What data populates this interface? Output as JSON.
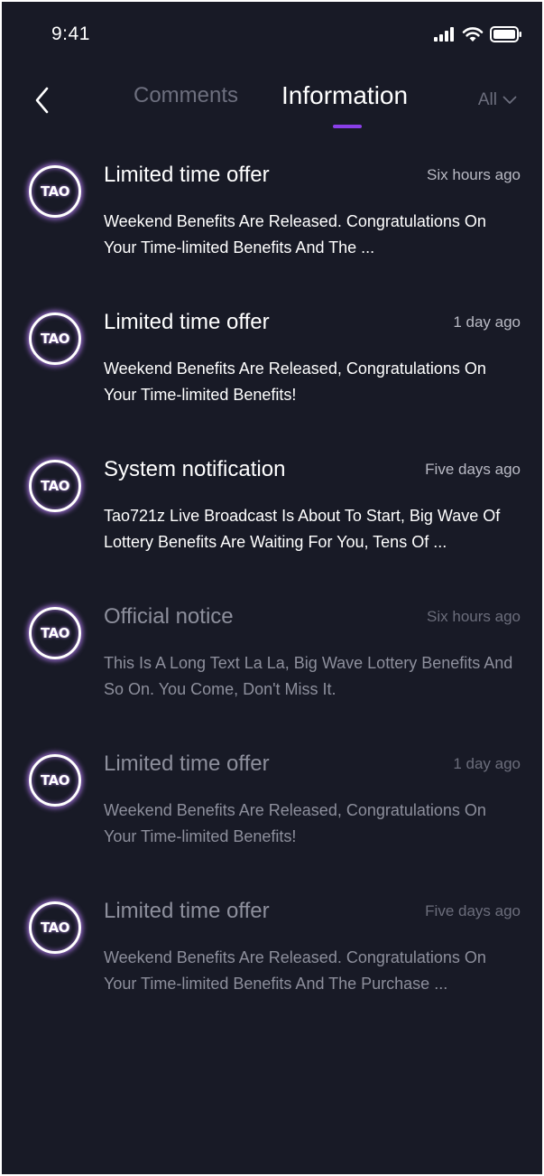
{
  "status_bar": {
    "time": "9:41",
    "icons": [
      "signal-icon",
      "wifi-icon",
      "battery-icon"
    ]
  },
  "nav": {
    "back_icon": "chevron-left-icon",
    "tabs": [
      {
        "label": "Comments",
        "active": false
      },
      {
        "label": "Information",
        "active": true
      }
    ],
    "filter_label": "All",
    "filter_icon": "chevron-down-icon"
  },
  "colors": {
    "background": "#181a26",
    "active_tab": "#ffffff",
    "inactive_tab": "#6d6f7e",
    "accent": "#8a3fe8",
    "avatar_glow": "#be82ff"
  },
  "avatar_label": "TAO",
  "messages": [
    {
      "title": "Limited time offer",
      "time": "Six hours ago",
      "body": "Weekend Benefits Are Released. Congratulations On Your Time-limited Benefits And The ...",
      "read": false
    },
    {
      "title": "Limited time offer",
      "time": "1 day ago",
      "body": "Weekend Benefits Are Released, Congratulations On Your Time-limited Benefits!",
      "read": false
    },
    {
      "title": "System notification",
      "time": "Five days ago",
      "body": "Tao721z Live Broadcast Is About To Start, Big Wave Of Lottery Benefits Are Waiting For You, Tens Of ...",
      "read": false
    },
    {
      "title": "Official notice",
      "time": "Six hours ago",
      "body": "This Is A Long Text La La, Big Wave Lottery Benefits And So On. You Come, Don't Miss It.",
      "read": true
    },
    {
      "title": "Limited time offer",
      "time": "1 day ago",
      "body": "Weekend Benefits Are Released, Congratulations On Your Time-limited Benefits!",
      "read": true
    },
    {
      "title": "Limited time offer",
      "time": "Five days ago",
      "body": "Weekend Benefits Are Released. Congratulations On Your Time-limited Benefits And The Purchase ...",
      "read": true
    }
  ]
}
